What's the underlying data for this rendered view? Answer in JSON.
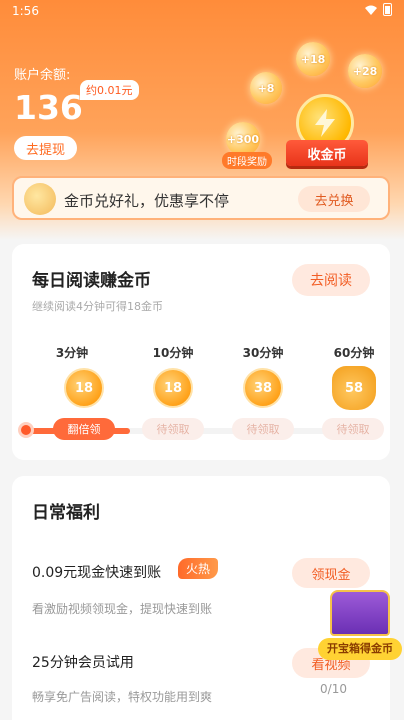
{
  "status_bar": {
    "time": "1:56"
  },
  "account": {
    "balance_label": "账户余额:",
    "balance": "136",
    "approx": "约0.01元",
    "withdraw_label": "去提现"
  },
  "bubbles": [
    {
      "value": "+18"
    },
    {
      "value": "+28"
    },
    {
      "value": "+8"
    },
    {
      "value": "+300",
      "label": "时段奖励"
    }
  ],
  "collect_label": "收金币",
  "exchange": {
    "text": "金币兑好礼，优惠享不停",
    "button": "去兑换"
  },
  "reading": {
    "title": "每日阅读赚金币",
    "subtitle": "继续阅读4分钟可得18金币",
    "button": "去阅读",
    "steps": [
      {
        "time": "3分钟",
        "coins": "18",
        "button": "翻倍领",
        "state": "active"
      },
      {
        "time": "10分钟",
        "coins": "18",
        "button": "待领取",
        "state": "pending"
      },
      {
        "time": "30分钟",
        "coins": "38",
        "button": "待领取",
        "state": "pending"
      },
      {
        "time": "60分钟",
        "coins": "58",
        "button": "待领取",
        "state": "pending"
      }
    ]
  },
  "welfare": {
    "title": "日常福利",
    "tasks": [
      {
        "title": "0.09元现金快速到账",
        "tag": "火热",
        "desc": "看激励视频领现金，提现快速到账",
        "button": "领现金",
        "progress": "0/"
      },
      {
        "title": "25分钟会员试用",
        "desc": "畅享免广告阅读，特权功能用到爽",
        "button": "看视频",
        "progress": "0/10"
      }
    ]
  },
  "treasure": {
    "label": "开宝箱得金币"
  },
  "colors": {
    "brand_orange": "#ff8c3a",
    "accent_red": "#ff5a2a",
    "coin_gold": "#ffa21a"
  }
}
